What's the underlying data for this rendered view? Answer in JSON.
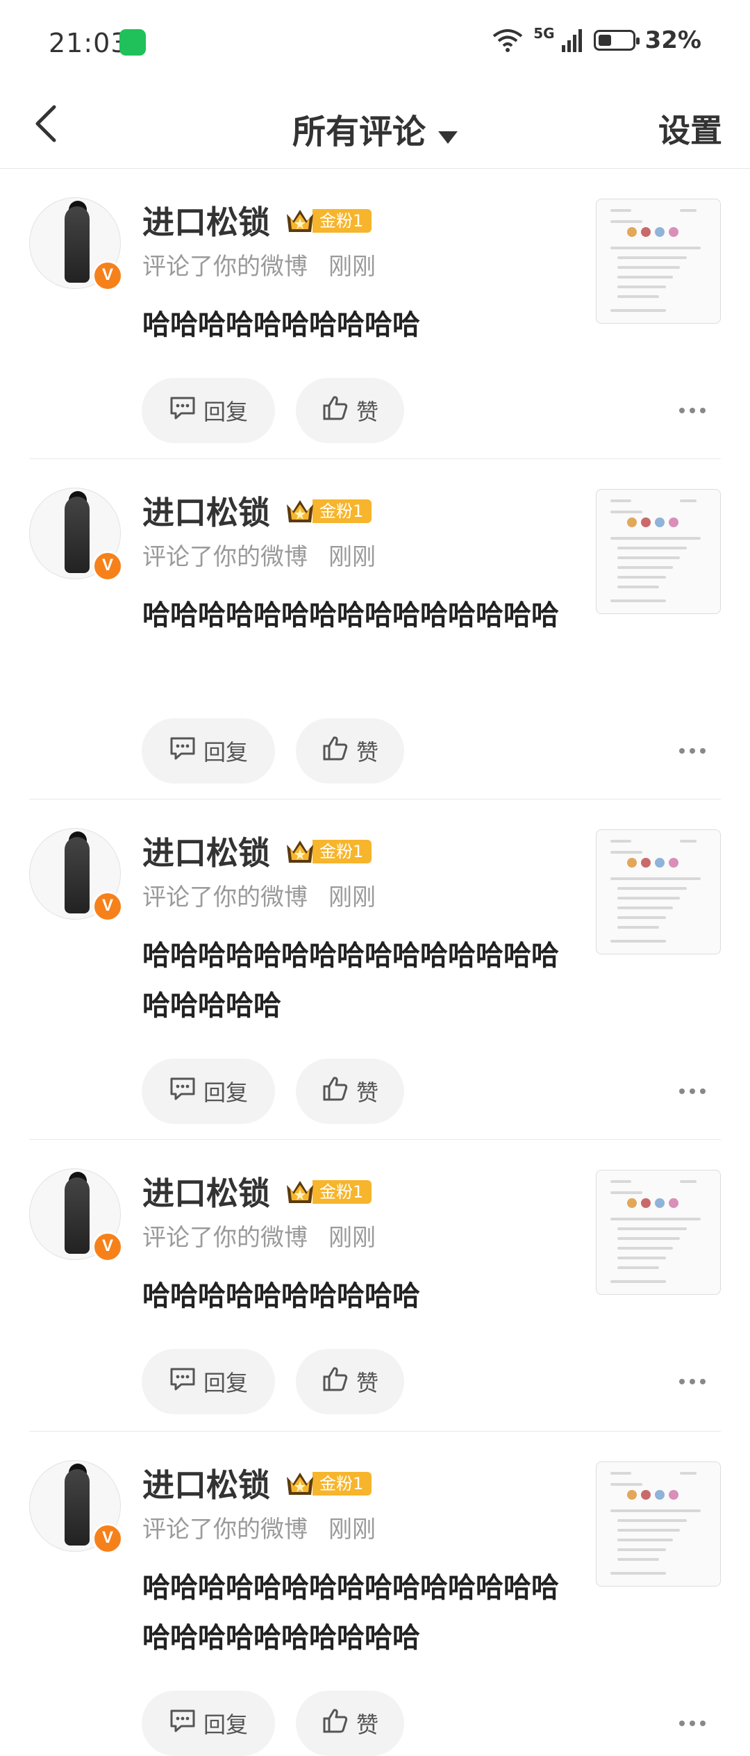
{
  "status_bar": {
    "time": "21:03",
    "network": "5G",
    "battery": "32%",
    "icons": [
      "wechat-icon",
      "wifi-icon",
      "signal-icon",
      "battery-icon"
    ]
  },
  "header": {
    "title": "所有评论",
    "settings_label": "设置",
    "icons": [
      "back-arrow-icon",
      "dropdown-caret-icon"
    ]
  },
  "colors": {
    "accent_orange": "#f6811b",
    "fan_badge": "#f6b52c",
    "subtitle_gray": "#9a9a9a",
    "button_bg": "#f3f3f3"
  },
  "comments": [
    {
      "username": "进口松锁",
      "fan_badge": "金粉1",
      "action": "评论了你的微博",
      "time": "刚刚",
      "text": "哈哈哈哈哈哈哈哈哈哈",
      "reply_label": "回复",
      "like_label": "赞"
    },
    {
      "username": "进口松锁",
      "fan_badge": "金粉1",
      "action": "评论了你的微博",
      "time": "刚刚",
      "text": "哈哈哈哈哈哈哈哈哈哈哈哈哈哈哈",
      "reply_label": "回复",
      "like_label": "赞"
    },
    {
      "username": "进口松锁",
      "fan_badge": "金粉1",
      "action": "评论了你的微博",
      "time": "刚刚",
      "text": "哈哈哈哈哈哈哈哈哈哈哈哈哈哈哈哈哈哈哈哈",
      "reply_label": "回复",
      "like_label": "赞"
    },
    {
      "username": "进口松锁",
      "fan_badge": "金粉1",
      "action": "评论了你的微博",
      "time": "刚刚",
      "text": "哈哈哈哈哈哈哈哈哈哈",
      "reply_label": "回复",
      "like_label": "赞"
    },
    {
      "username": "进口松锁",
      "fan_badge": "金粉1",
      "action": "评论了你的微博",
      "time": "刚刚",
      "text": "哈哈哈哈哈哈哈哈哈哈哈哈哈哈哈哈哈哈哈哈哈哈哈哈哈",
      "reply_label": "回复",
      "like_label": "赞"
    }
  ]
}
